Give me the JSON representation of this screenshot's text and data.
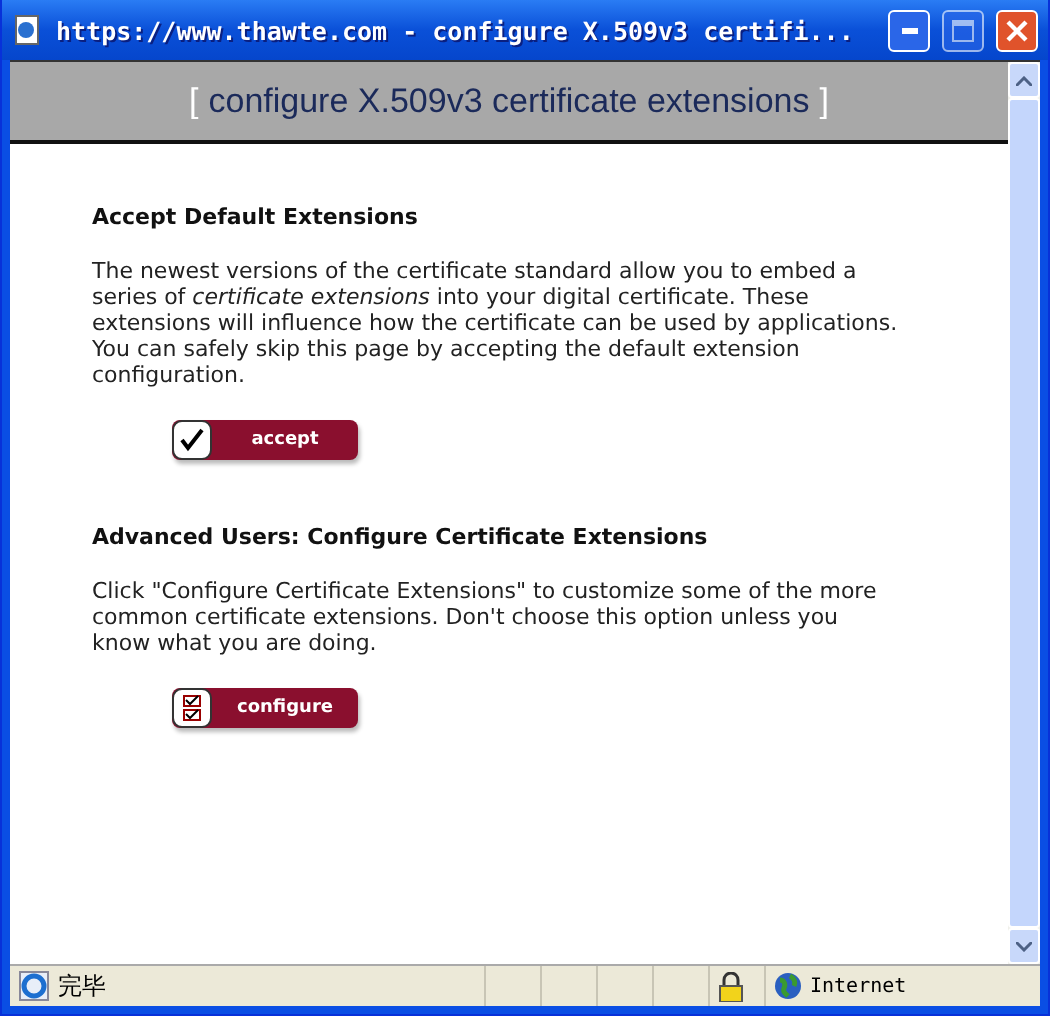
{
  "window": {
    "title": "https://www.thawte.com - configure X.509v3 certifi..."
  },
  "header": {
    "bracket_open": "[",
    "title": "configure X.509v3 certificate extensions",
    "bracket_close": "]"
  },
  "sections": [
    {
      "heading": "Accept Default Extensions",
      "text": "The newest versions of the certificate standard allow you to embed a series of *certificate extensions* into your digital certificate. These extensions will influence how the certificate can be used by applications. You can safely skip this page by accepting the default extension configuration.",
      "button": {
        "label": "accept",
        "kind": "check"
      }
    },
    {
      "heading": "Advanced Users: Configure Certificate Extensions",
      "text": "Click \"Configure Certificate Extensions\" to customize some of the more common certificate extensions. Don't choose this option unless you know what you are doing.",
      "button": {
        "label": "configure",
        "kind": "list"
      }
    }
  ],
  "status_bar": {
    "status": "完毕",
    "zone": "Internet"
  }
}
